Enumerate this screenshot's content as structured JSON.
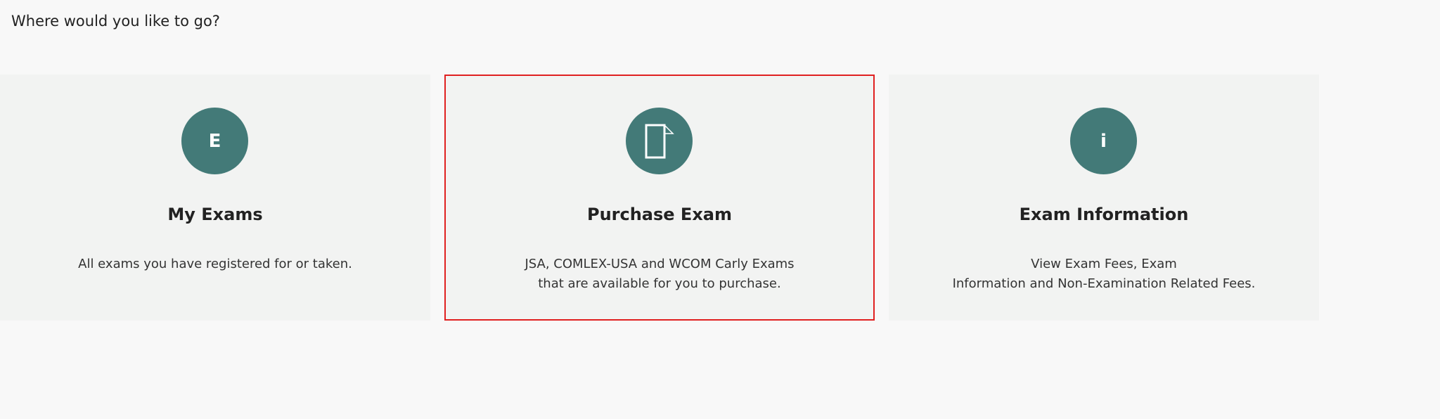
{
  "header": {
    "prompt": "Where would you like to go?"
  },
  "cards": [
    {
      "icon": "letter-e-icon",
      "icon_text": "E",
      "title": "My Exams",
      "description": [
        "All exams you have registered for or taken."
      ],
      "selected": false
    },
    {
      "icon": "document-icon",
      "icon_text": "",
      "title": "Purchase Exam",
      "description": [
        "JSA, COMLEX-USA and WCOM Carly Exams",
        "that are available for you to purchase."
      ],
      "selected": true
    },
    {
      "icon": "info-icon",
      "icon_text": "i",
      "title": "Exam Information",
      "description": [
        "View Exam Fees, Exam",
        "Information and Non-Examination Related Fees."
      ],
      "selected": false
    }
  ],
  "colors": {
    "background": "#f8f8f8",
    "card_background": "#f2f3f2",
    "icon_circle": "#437a78",
    "selection_border": "#e02020"
  }
}
